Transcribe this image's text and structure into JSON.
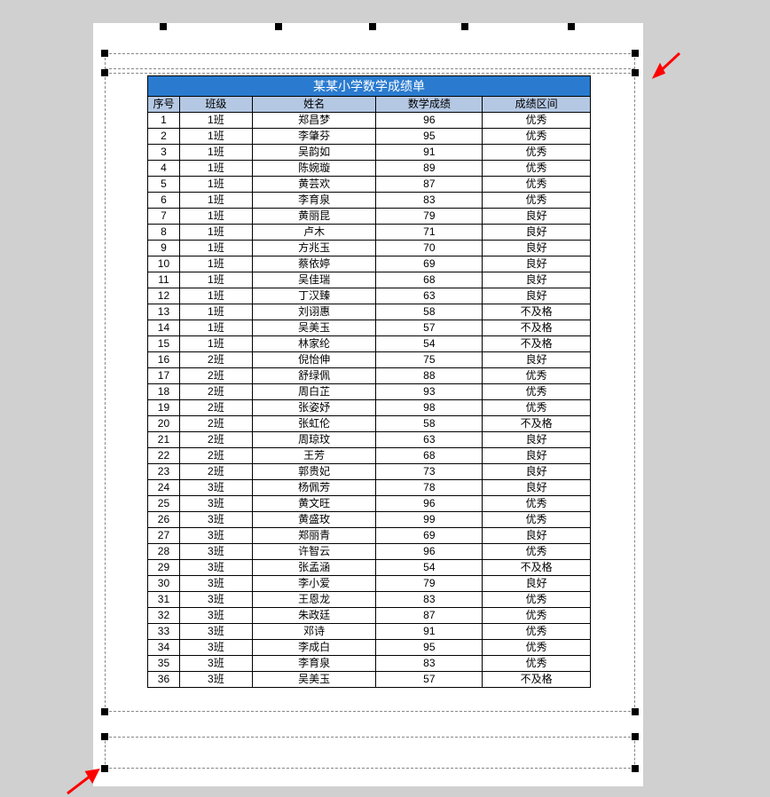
{
  "title": "某某小学数学成绩单",
  "columns": [
    "序号",
    "班级",
    "姓名",
    "数学成绩",
    "成绩区间"
  ],
  "rows": [
    {
      "idx": 1,
      "class": "1班",
      "name": "郑昌梦",
      "score": 96,
      "grade": "优秀"
    },
    {
      "idx": 2,
      "class": "1班",
      "name": "李肇芬",
      "score": 95,
      "grade": "优秀"
    },
    {
      "idx": 3,
      "class": "1班",
      "name": "吴韵如",
      "score": 91,
      "grade": "优秀"
    },
    {
      "idx": 4,
      "class": "1班",
      "name": "陈婉璇",
      "score": 89,
      "grade": "优秀"
    },
    {
      "idx": 5,
      "class": "1班",
      "name": "黄芸欢",
      "score": 87,
      "grade": "优秀"
    },
    {
      "idx": 6,
      "class": "1班",
      "name": "李育泉",
      "score": 83,
      "grade": "优秀"
    },
    {
      "idx": 7,
      "class": "1班",
      "name": "黄丽昆",
      "score": 79,
      "grade": "良好"
    },
    {
      "idx": 8,
      "class": "1班",
      "name": "卢木",
      "score": 71,
      "grade": "良好"
    },
    {
      "idx": 9,
      "class": "1班",
      "name": "方兆玉",
      "score": 70,
      "grade": "良好"
    },
    {
      "idx": 10,
      "class": "1班",
      "name": "蔡依婷",
      "score": 69,
      "grade": "良好"
    },
    {
      "idx": 11,
      "class": "1班",
      "name": "吴佳瑞",
      "score": 68,
      "grade": "良好"
    },
    {
      "idx": 12,
      "class": "1班",
      "name": "丁汉臻",
      "score": 63,
      "grade": "良好"
    },
    {
      "idx": 13,
      "class": "1班",
      "name": "刘诩惠",
      "score": 58,
      "grade": "不及格"
    },
    {
      "idx": 14,
      "class": "1班",
      "name": "吴美玉",
      "score": 57,
      "grade": "不及格"
    },
    {
      "idx": 15,
      "class": "1班",
      "name": "林家纶",
      "score": 54,
      "grade": "不及格"
    },
    {
      "idx": 16,
      "class": "2班",
      "name": "倪怡伸",
      "score": 75,
      "grade": "良好"
    },
    {
      "idx": 17,
      "class": "2班",
      "name": "舒绿佩",
      "score": 88,
      "grade": "优秀"
    },
    {
      "idx": 18,
      "class": "2班",
      "name": "周白芷",
      "score": 93,
      "grade": "优秀"
    },
    {
      "idx": 19,
      "class": "2班",
      "name": "张姿妤",
      "score": 98,
      "grade": "优秀"
    },
    {
      "idx": 20,
      "class": "2班",
      "name": "张虹伦",
      "score": 58,
      "grade": "不及格"
    },
    {
      "idx": 21,
      "class": "2班",
      "name": "周琼玟",
      "score": 63,
      "grade": "良好"
    },
    {
      "idx": 22,
      "class": "2班",
      "name": "王芳",
      "score": 68,
      "grade": "良好"
    },
    {
      "idx": 23,
      "class": "2班",
      "name": "郭贵妃",
      "score": 73,
      "grade": "良好"
    },
    {
      "idx": 24,
      "class": "3班",
      "name": "杨佩芳",
      "score": 78,
      "grade": "良好"
    },
    {
      "idx": 25,
      "class": "3班",
      "name": "黄文旺",
      "score": 96,
      "grade": "优秀"
    },
    {
      "idx": 26,
      "class": "3班",
      "name": "黄盛玫",
      "score": 99,
      "grade": "优秀"
    },
    {
      "idx": 27,
      "class": "3班",
      "name": "郑丽青",
      "score": 69,
      "grade": "良好"
    },
    {
      "idx": 28,
      "class": "3班",
      "name": "许智云",
      "score": 96,
      "grade": "优秀"
    },
    {
      "idx": 29,
      "class": "3班",
      "name": "张孟涵",
      "score": 54,
      "grade": "不及格"
    },
    {
      "idx": 30,
      "class": "3班",
      "name": "李小爱",
      "score": 79,
      "grade": "良好"
    },
    {
      "idx": 31,
      "class": "3班",
      "name": "王恩龙",
      "score": 83,
      "grade": "优秀"
    },
    {
      "idx": 32,
      "class": "3班",
      "name": "朱政廷",
      "score": 87,
      "grade": "优秀"
    },
    {
      "idx": 33,
      "class": "3班",
      "name": "邓诗",
      "score": 91,
      "grade": "优秀"
    },
    {
      "idx": 34,
      "class": "3班",
      "name": "李成白",
      "score": 95,
      "grade": "优秀"
    },
    {
      "idx": 35,
      "class": "3班",
      "name": "李育泉",
      "score": 83,
      "grade": "优秀"
    },
    {
      "idx": 36,
      "class": "3班",
      "name": "吴美玉",
      "score": 57,
      "grade": "不及格"
    }
  ]
}
